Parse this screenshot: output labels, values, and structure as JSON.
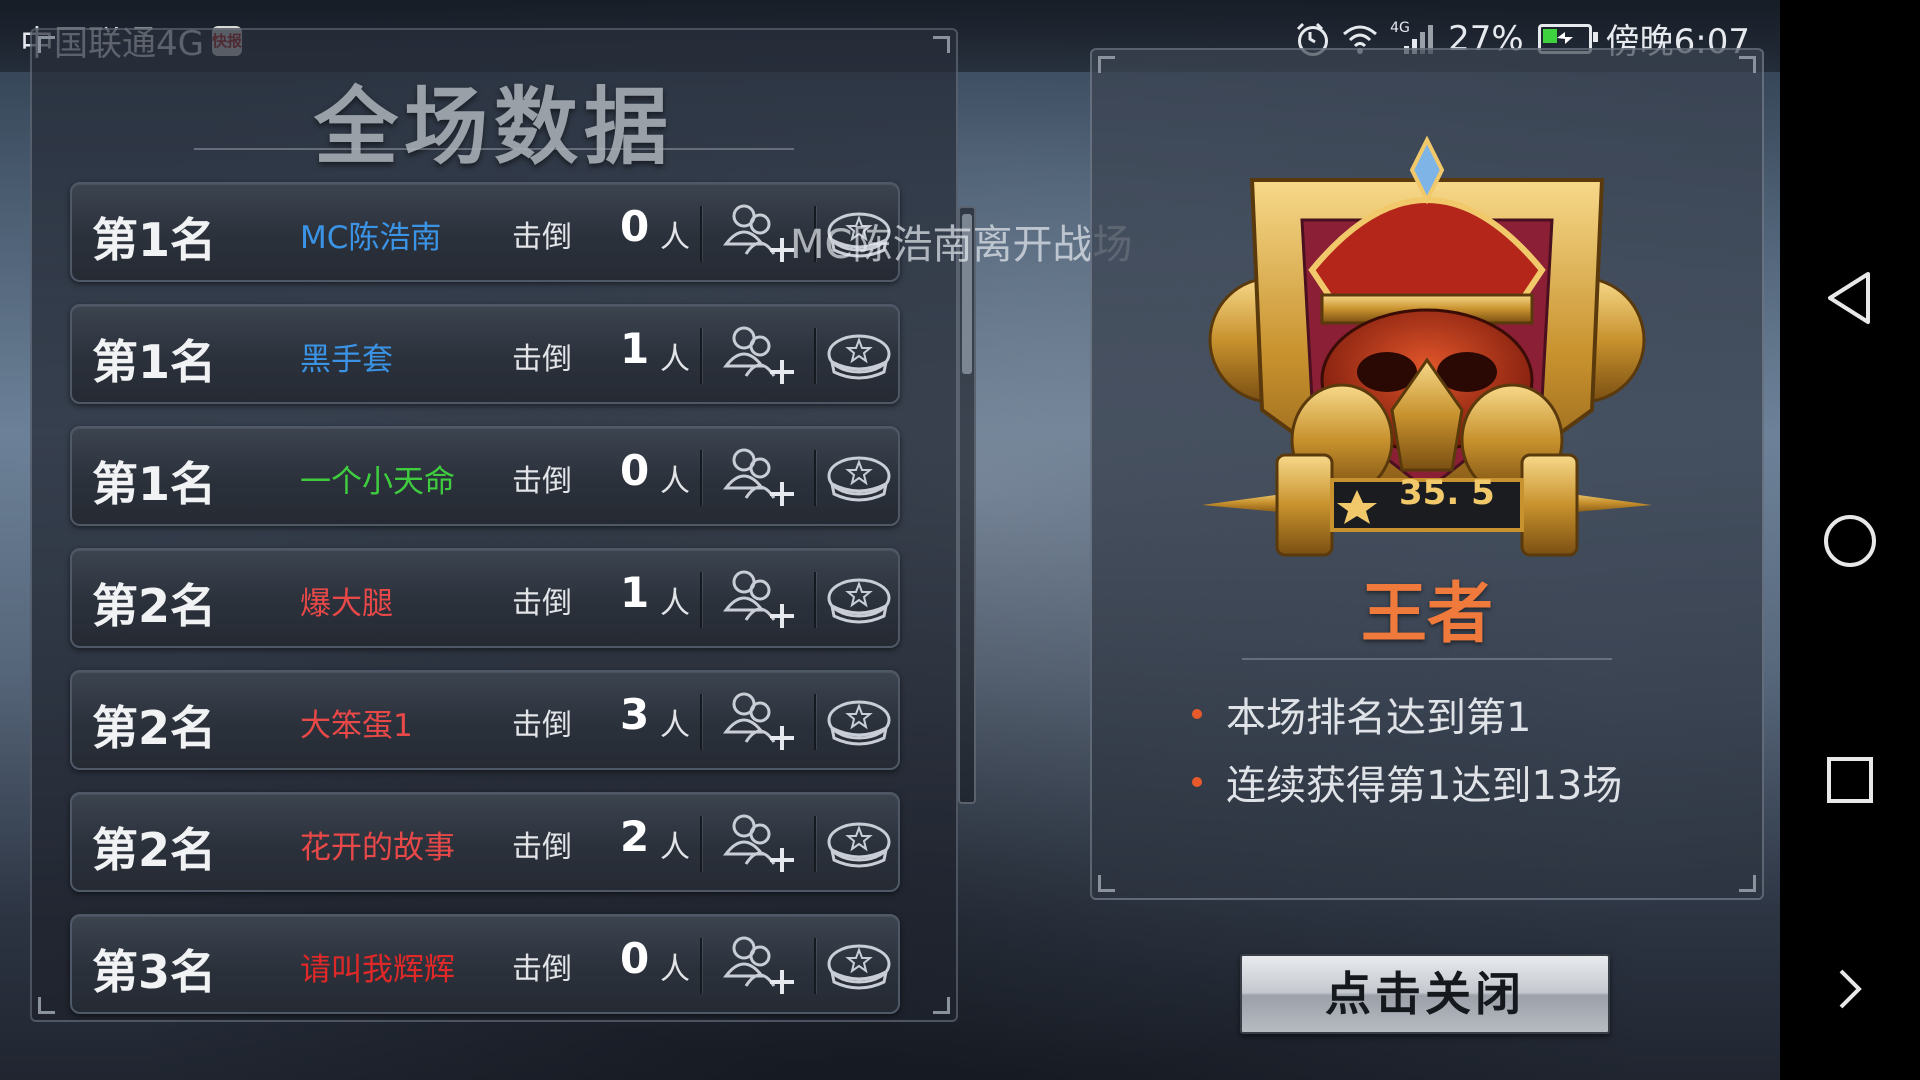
{
  "status_bar": {
    "carrier": "中国联通4G",
    "carrier_badge": "快报",
    "battery_percent": "27%",
    "time": "傍晚6:07",
    "network_tag": "4G"
  },
  "left_panel": {
    "title": "全场数据",
    "overlay_message": "MC陈浩南离开战场",
    "kill_label": "击倒",
    "kill_unit": "人",
    "rows": [
      {
        "rank": "第1名",
        "name": "MC陈浩南",
        "kills": "0",
        "name_color": "#3b93e6"
      },
      {
        "rank": "第1名",
        "name": "黑手套",
        "kills": "1",
        "name_color": "#3b93e6"
      },
      {
        "rank": "第1名",
        "name": "一个小天命",
        "kills": "0",
        "name_color": "#3fcd3f"
      },
      {
        "rank": "第2名",
        "name": "爆大腿",
        "kills": "1",
        "name_color": "#e84848"
      },
      {
        "rank": "第2名",
        "name": "大笨蛋1",
        "kills": "3",
        "name_color": "#e84848"
      },
      {
        "rank": "第2名",
        "name": "花开的故事",
        "kills": "2",
        "name_color": "#e84848"
      },
      {
        "rank": "第3名",
        "name": "请叫我辉辉",
        "kills": "0",
        "name_color": "#e02828"
      }
    ]
  },
  "right_panel": {
    "emblem_score": "35. 5",
    "rank_title": "王者",
    "achievements": [
      "本场排名达到第1",
      "连续获得第1达到13场"
    ],
    "title_color": "#f07a3c"
  },
  "close_button": {
    "label": "点击关闭"
  },
  "icons": [
    "alarm-icon",
    "wifi-icon",
    "signal-icon",
    "battery-icon",
    "add-friend-icon",
    "medal-icon",
    "back-icon",
    "home-icon",
    "recents-icon",
    "chevron-right-icon"
  ]
}
